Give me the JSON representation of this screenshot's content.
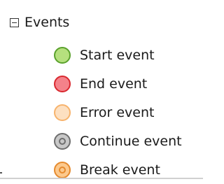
{
  "tree": {
    "root_label": "Events",
    "items": [
      {
        "label": "Start event",
        "icon": "start-event-icon",
        "fill": "#b5e07e",
        "stroke": "#5aa12c",
        "inner": false
      },
      {
        "label": "End event",
        "icon": "end-event-icon",
        "fill": "#f4828a",
        "stroke": "#d9282f",
        "inner": false
      },
      {
        "label": "Error event",
        "icon": "error-event-icon",
        "fill": "#fde0c1",
        "stroke": "#f7b36c",
        "inner": false
      },
      {
        "label": "Continue event",
        "icon": "continue-event-icon",
        "fill": "#c8c8c8",
        "stroke": "#6e6e6e",
        "inner": true
      },
      {
        "label": "Break event",
        "icon": "break-event-icon",
        "fill": "#fcc98d",
        "stroke": "#e58a2e",
        "inner": true
      }
    ]
  }
}
